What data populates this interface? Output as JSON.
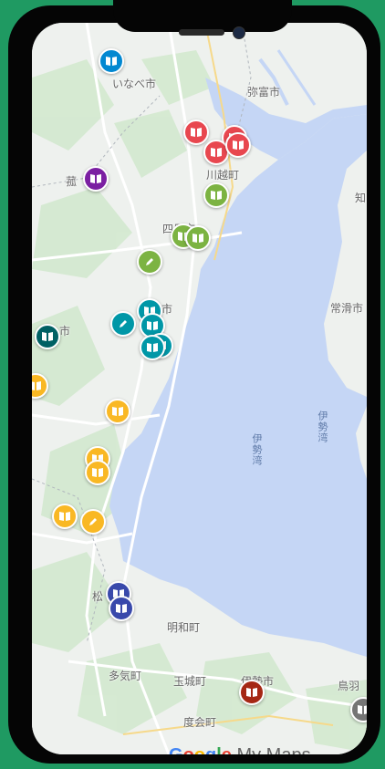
{
  "map": {
    "places": [
      {
        "id": "inabe",
        "label": "いなべ市"
      },
      {
        "id": "yatomi",
        "label": "弥富市"
      },
      {
        "id": "kawagoe",
        "label": "川越町"
      },
      {
        "id": "komono",
        "label": "菰"
      },
      {
        "id": "chita",
        "label": "知"
      },
      {
        "id": "yokkaichi",
        "label": "四日市"
      },
      {
        "id": "tsu_fragment",
        "label": "市"
      },
      {
        "id": "tokoname",
        "label": "常滑市"
      },
      {
        "id": "kameyama",
        "label": "市"
      },
      {
        "id": "matsusaka",
        "label": "松"
      },
      {
        "id": "meiwa",
        "label": "明和町"
      },
      {
        "id": "taki",
        "label": "多気町"
      },
      {
        "id": "tamaki",
        "label": "玉城町"
      },
      {
        "id": "ise",
        "label": "伊勢市"
      },
      {
        "id": "toba",
        "label": "鳥羽"
      },
      {
        "id": "watarai",
        "label": "度会町"
      }
    ],
    "bay_labels": [
      "伊勢湾",
      "伊勢湾"
    ],
    "attribution": {
      "google": "Google",
      "product": "My Maps"
    },
    "colors": {
      "red": "#e8474f",
      "green": "#7cb342",
      "purple": "#7b1fa2",
      "blue": "#0288d1",
      "teal": "#0097a7",
      "darkteal": "#006064",
      "yellow": "#f9b824",
      "navy": "#3949ab",
      "darkred": "#a52714",
      "gray": "#757575"
    },
    "markers": [
      {
        "color": "blue",
        "icon": "book-icon"
      },
      {
        "color": "red",
        "icon": "book-icon"
      },
      {
        "color": "red",
        "icon": "book-icon"
      },
      {
        "color": "red",
        "icon": "book-icon"
      },
      {
        "color": "red",
        "icon": "book-icon"
      },
      {
        "color": "purple",
        "icon": "book-icon"
      },
      {
        "color": "green",
        "icon": "book-icon"
      },
      {
        "color": "green",
        "icon": "book-icon"
      },
      {
        "color": "green",
        "icon": "book-icon"
      },
      {
        "color": "green",
        "icon": "pen-icon"
      },
      {
        "color": "teal",
        "icon": "book-icon"
      },
      {
        "color": "teal",
        "icon": "book-icon"
      },
      {
        "color": "teal",
        "icon": "pen-icon"
      },
      {
        "color": "teal",
        "icon": "book-icon"
      },
      {
        "color": "teal",
        "icon": "book-icon"
      },
      {
        "color": "darkteal",
        "icon": "book-icon"
      },
      {
        "color": "yellow",
        "icon": "book-icon"
      },
      {
        "color": "yellow",
        "icon": "book-icon"
      },
      {
        "color": "yellow",
        "icon": "book-icon"
      },
      {
        "color": "yellow",
        "icon": "book-icon"
      },
      {
        "color": "yellow",
        "icon": "book-icon"
      },
      {
        "color": "yellow",
        "icon": "pen-icon"
      },
      {
        "color": "navy",
        "icon": "book-icon"
      },
      {
        "color": "navy",
        "icon": "book-icon"
      },
      {
        "color": "darkred",
        "icon": "book-icon"
      },
      {
        "color": "gray",
        "icon": "book-icon"
      }
    ]
  }
}
